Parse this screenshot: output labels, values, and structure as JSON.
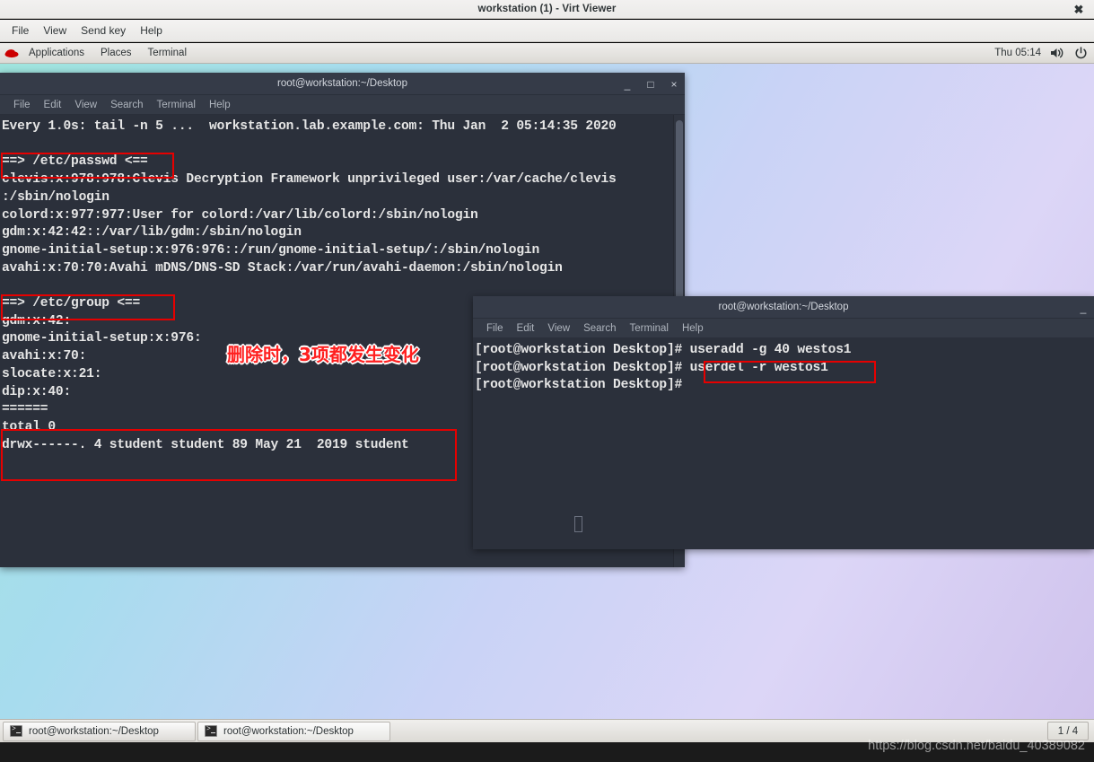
{
  "viewer": {
    "title": "workstation (1) - Virt Viewer",
    "close_icon": "close-icon",
    "menu": [
      "File",
      "View",
      "Send key",
      "Help"
    ]
  },
  "gnome_panel": {
    "logo_icon": "redhat-logo-icon",
    "items": [
      "Applications",
      "Places",
      "Terminal"
    ],
    "clock": "Thu 05:14",
    "volume_icon": "volume-icon",
    "power_icon": "power-icon"
  },
  "terminal1": {
    "title": "root@workstation:~/Desktop",
    "menu": [
      "File",
      "Edit",
      "View",
      "Search",
      "Terminal",
      "Help"
    ],
    "minimize": "_",
    "maximize": "□",
    "close": "×",
    "content": "Every 1.0s: tail -n 5 ...  workstation.lab.example.com: Thu Jan  2 05:14:35 2020\n\n==> /etc/passwd <==\nclevis:x:978:978:Clevis Decryption Framework unprivileged user:/var/cache/clevis\n:/sbin/nologin\ncolord:x:977:977:User for colord:/var/lib/colord:/sbin/nologin\ngdm:x:42:42::/var/lib/gdm:/sbin/nologin\ngnome-initial-setup:x:976:976::/run/gnome-initial-setup/:/sbin/nologin\navahi:x:70:70:Avahi mDNS/DNS-SD Stack:/var/run/avahi-daemon:/sbin/nologin\n\n==> /etc/group <==\ngdm:x:42:\ngnome-initial-setup:x:976:\navahi:x:70:\nslocate:x:21:\ndip:x:40:\n======\ntotal 0\ndrwx------. 4 student student 89 May 21  2019 student"
  },
  "terminal2": {
    "title": "root@workstation:~/Desktop",
    "menu": [
      "File",
      "Edit",
      "View",
      "Search",
      "Terminal",
      "Help"
    ],
    "minimize": "_",
    "content": "[root@workstation Desktop]# useradd -g 40 westos1\n[root@workstation Desktop]# userdel -r westos1\n[root@workstation Desktop]#"
  },
  "annotations": {
    "note_text": "删除时，3项都发生变化",
    "highlight_color": "#e60000",
    "boxes": [
      {
        "name": "highlight-etc-passwd",
        "label": "==> /etc/passwd <=="
      },
      {
        "name": "highlight-etc-group",
        "label": "==> /etc/group <=="
      },
      {
        "name": "highlight-student-dir",
        "label": "drwx------. 4 student student 89 May 21  2019 student"
      },
      {
        "name": "highlight-userdel-command",
        "label": "userdel -r westos1"
      }
    ]
  },
  "taskbar": {
    "buttons": [
      {
        "label": "root@workstation:~/Desktop",
        "icon": "terminal-icon"
      },
      {
        "label": "root@workstation:~/Desktop",
        "icon": "terminal-icon"
      }
    ],
    "workspace": "1 / 4"
  },
  "watermark": "https://blog.csdn.net/baidu_40389082"
}
